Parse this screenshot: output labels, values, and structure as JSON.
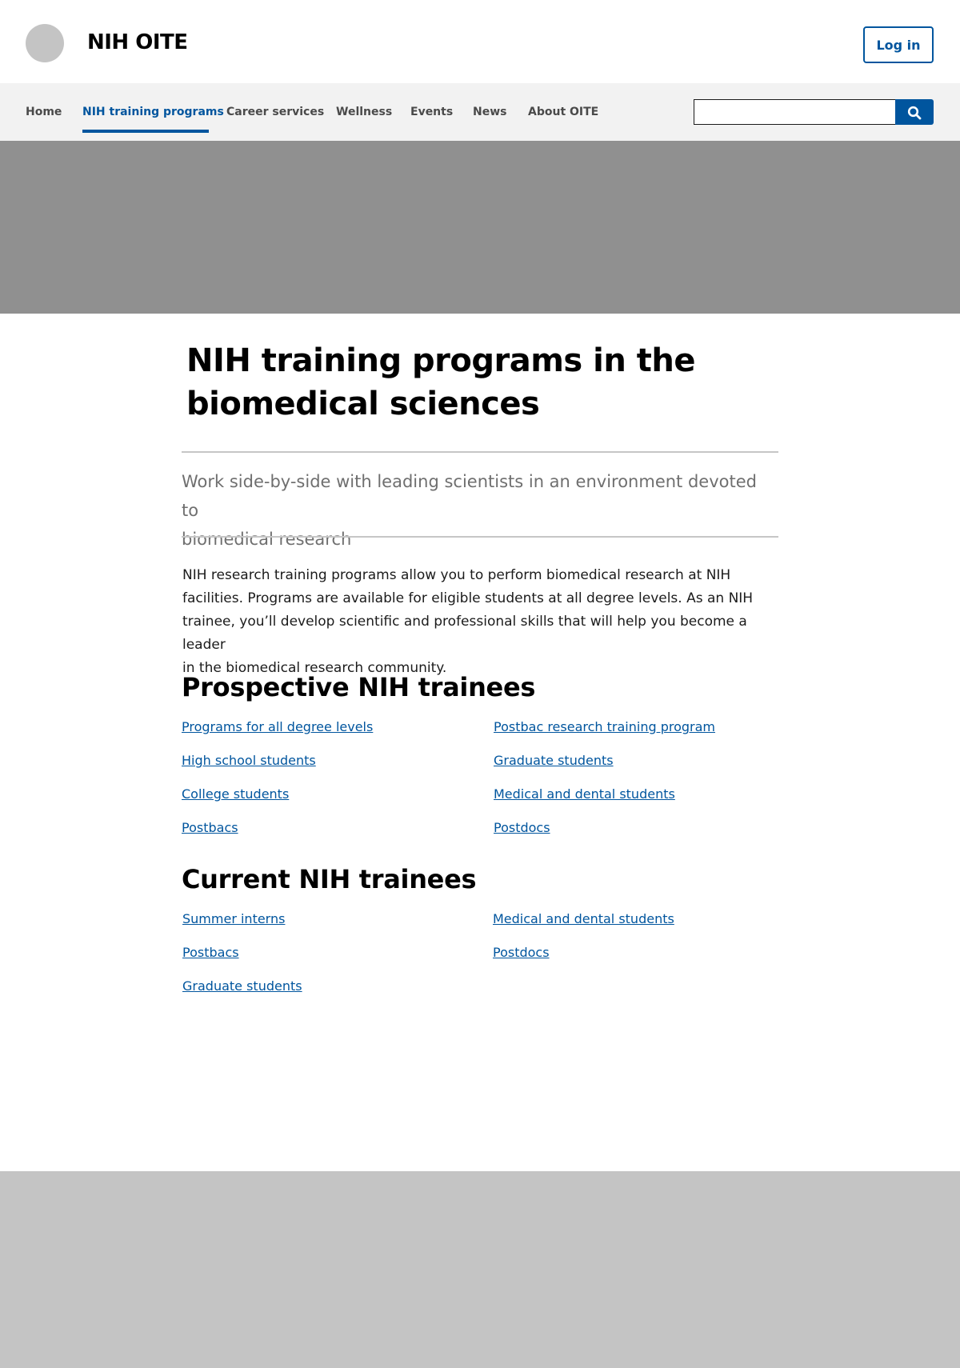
{
  "header": {
    "site_title": "NIH OITE",
    "login_label": "Log in"
  },
  "nav": {
    "items": [
      {
        "label": "Home"
      },
      {
        "label": "NIH training programs",
        "active": true
      },
      {
        "label": "Career services"
      },
      {
        "label": "Wellness"
      },
      {
        "label": "Events"
      },
      {
        "label": "News"
      },
      {
        "label": "About OITE"
      }
    ],
    "search_value": "",
    "search_icon": "search-icon"
  },
  "main": {
    "title_line1": "NIH training programs in the",
    "title_line2": "biomedical sciences",
    "lede_line1": "Work side-by-side with leading scientists in an environment devoted to",
    "lede_line2": "biomedical research",
    "intro_lines": [
      "NIH research training programs allow you to perform biomedical research at NIH",
      "facilities. Programs are available for eligible students at all degree levels. As an NIH",
      "trainee, you’ll develop scientific and professional skills that will help you become a leader",
      "in the biomedical research community."
    ],
    "prospective": {
      "heading": "Prospective NIH trainees",
      "left_links": [
        "Programs for all degree levels",
        "High school students",
        "College students",
        "Postbacs"
      ],
      "right_links": [
        "Postbac research training program",
        "Graduate students",
        "Medical and dental students",
        "Postdocs"
      ]
    },
    "current": {
      "heading": "Current NIH trainees",
      "left_links": [
        "Summer interns",
        "Postbacs",
        "Graduate students"
      ],
      "right_links": [
        "Medical and dental students",
        "Postdocs"
      ]
    }
  },
  "colors": {
    "accent": "#00559e",
    "hero": "#909090",
    "footer": "#c4c4c4",
    "nav_bg": "#f2f2f2"
  }
}
